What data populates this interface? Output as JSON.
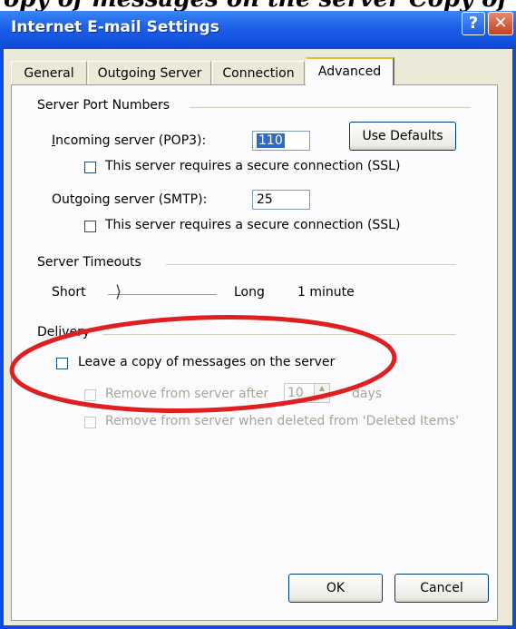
{
  "cropped_heading": "opy of messages on the server Copy of messages (message copy) of original message",
  "window": {
    "title": "Internet E-mail Settings",
    "help_glyph": "?",
    "close_glyph": "✕"
  },
  "tabs": [
    {
      "label": "General"
    },
    {
      "label": "Outgoing Server"
    },
    {
      "label": "Connection"
    },
    {
      "label": "Advanced"
    }
  ],
  "server_ports": {
    "group_title": "Server Port Numbers",
    "incoming_label": "Incoming server (POP3):",
    "incoming_value": "110",
    "use_defaults_label": "Use Defaults",
    "incoming_ssl_label": "This server requires a secure connection (SSL)",
    "outgoing_label": "Outgoing server (SMTP):",
    "outgoing_value": "25",
    "outgoing_ssl_label": "This server requires a secure connection (SSL)"
  },
  "timeouts": {
    "group_title": "Server Timeouts",
    "short_label": "Short",
    "long_label": "Long",
    "value_text": "1 minute",
    "slider_level": 0.1
  },
  "delivery": {
    "group_title": "Delivery",
    "leave_copy_label": "Leave a copy of messages on the server",
    "remove_after_label": "Remove from server after",
    "remove_after_days": "10",
    "days_label": "days",
    "remove_deleted_label": "Remove from server when deleted from 'Deleted Items'"
  },
  "footer": {
    "ok_label": "OK",
    "cancel_label": "Cancel"
  },
  "annotation_color": "#e02020"
}
